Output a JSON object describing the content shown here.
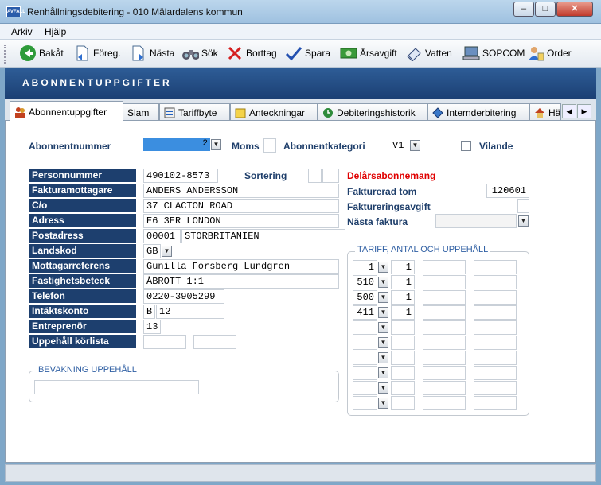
{
  "window": {
    "title": "Renhållningsdebitering  -  010 Mälardalens kommun",
    "app_badge": "AVFALL",
    "min": "–",
    "max": "□",
    "close": "✕"
  },
  "menu": [
    "Arkiv",
    "Hjälp"
  ],
  "toolbar": [
    {
      "label": "Bakåt",
      "icon": "back-arrow-icon"
    },
    {
      "label": "Föreg.",
      "icon": "previous-document-icon"
    },
    {
      "label": "Nästa",
      "icon": "next-document-icon"
    },
    {
      "label": "Sök",
      "icon": "binoculars-icon"
    },
    {
      "label": "Borttag",
      "icon": "delete-x-icon"
    },
    {
      "label": "Spara",
      "icon": "checkmark-icon"
    },
    {
      "label": "Årsavgift",
      "icon": "money-icon"
    },
    {
      "label": "Vatten",
      "icon": "water-icon"
    },
    {
      "label": "SOPCOM",
      "icon": "computer-icon"
    },
    {
      "label": "Order",
      "icon": "order-person-icon"
    }
  ],
  "header": "ABONNENTUPPGIFTER",
  "tabs": [
    "Abonnentuppgifter",
    "Slam",
    "Tariffbyte",
    "Anteckningar",
    "Debiteringshistorik",
    "Internderbitering",
    "Hä"
  ],
  "top": {
    "abonnentnummer_label": "Abonnentnummer",
    "abonnentnummer_value": "2",
    "moms_label": "Moms",
    "kategori_label": "Abonnentkategori",
    "kategori_value": "V1",
    "vilande_label": "Vilande"
  },
  "fields": [
    {
      "label": "Personnummer",
      "value": "490102-8573"
    },
    {
      "label": "Fakturamottagare",
      "value": "ANDERS ANDERSSON"
    },
    {
      "label": "C/o",
      "value": "37 CLACTON ROAD"
    },
    {
      "label": "Adress",
      "value": "E6 3ER LONDON"
    },
    {
      "label": "Postadress",
      "value": "00001",
      "value2": "STORBRITANIEN"
    },
    {
      "label": "Landskod",
      "value": "GB"
    },
    {
      "label": "Mottagarreferens",
      "value": "Gunilla Forsberg Lundgren"
    },
    {
      "label": "Fastighetsbeteck",
      "value": "ÅBROTT 1:1"
    },
    {
      "label": "Telefon",
      "value": "0220-3905299"
    },
    {
      "label": "Intäktskonto",
      "value": "B",
      "value2": "12"
    },
    {
      "label": "Entreprenör",
      "value": "13"
    },
    {
      "label": "Uppehåll körlista",
      "value": "",
      "value2": ""
    }
  ],
  "sortering_label": "Sortering",
  "right": {
    "delars_label": "Delårsabonnemang",
    "fakturerad_label": "Fakturerad tom",
    "fakturerad_value": "120601",
    "avgift_label": "Faktureringsavgift",
    "nasta_label": "Nästa faktura"
  },
  "bevakning_title": "BEVAKNING UPPEHÅLL",
  "tariff_title": "TARIFF, ANTAL OCH UPPEHÅLL",
  "tariff_rows": [
    {
      "tariff": "1",
      "antal": "1"
    },
    {
      "tariff": "510",
      "antal": "1"
    },
    {
      "tariff": "500",
      "antal": "1"
    },
    {
      "tariff": "411",
      "antal": "1"
    },
    {
      "tariff": "",
      "antal": ""
    },
    {
      "tariff": "",
      "antal": ""
    },
    {
      "tariff": "",
      "antal": ""
    },
    {
      "tariff": "",
      "antal": ""
    },
    {
      "tariff": "",
      "antal": ""
    },
    {
      "tariff": "",
      "antal": ""
    }
  ],
  "colors": {
    "navy": "#1d3f6e",
    "red": "#e00000",
    "link_blue": "#2f5fa3"
  }
}
